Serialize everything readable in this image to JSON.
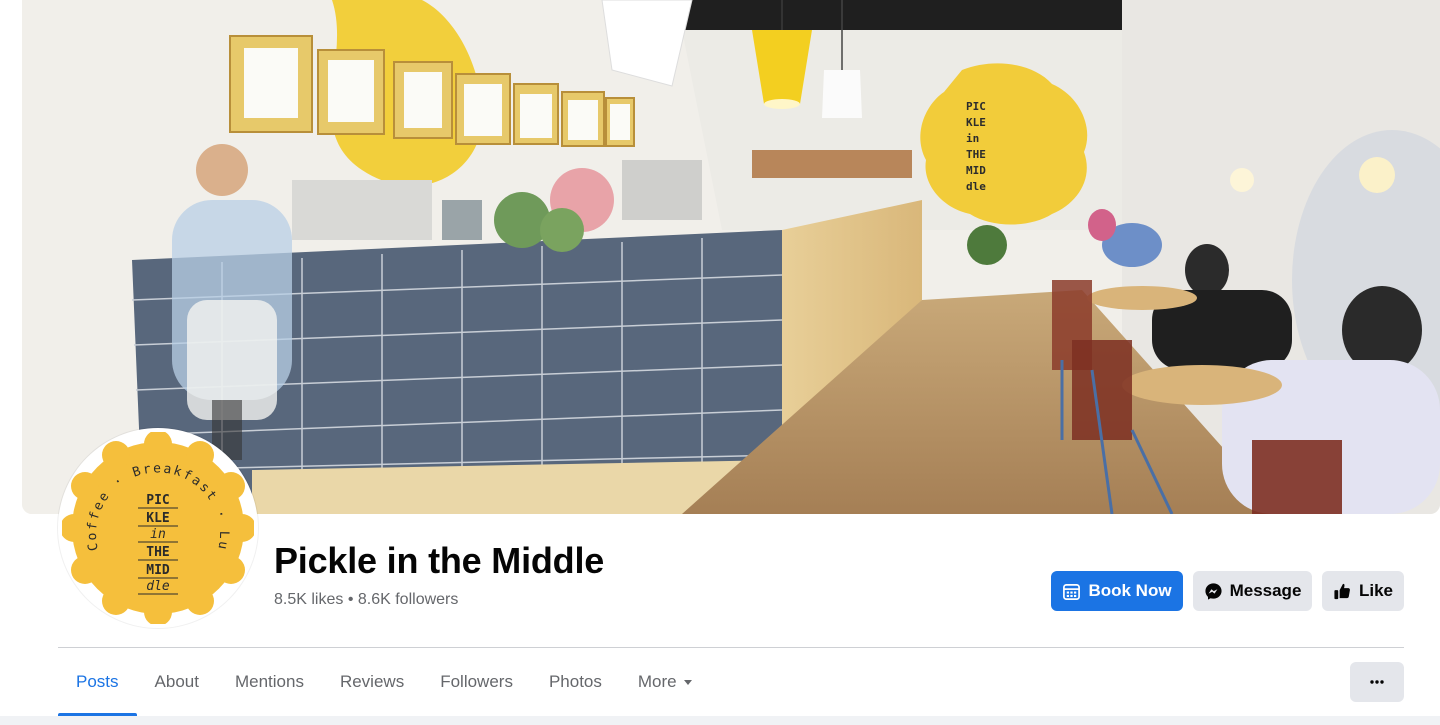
{
  "page": {
    "name": "Pickle in the Middle",
    "likes": "8.5K likes",
    "separator": " • ",
    "followers": "8.6K followers"
  },
  "cover": {
    "wall_logo": [
      "PIC",
      "KLE",
      "in",
      "THE",
      "MID",
      "dle"
    ]
  },
  "avatar": {
    "arc_text": "Coffee · Breakfast · Lunch",
    "logo_lines": [
      "PIC",
      "KLE",
      "in",
      "THE",
      "MID",
      "dle"
    ]
  },
  "actions": {
    "book_now": "Book Now",
    "message": "Message",
    "like": "Like"
  },
  "tabs": [
    {
      "label": "Posts",
      "active": true
    },
    {
      "label": "About"
    },
    {
      "label": "Mentions"
    },
    {
      "label": "Reviews"
    },
    {
      "label": "Followers"
    },
    {
      "label": "Photos"
    },
    {
      "label": "More"
    }
  ],
  "colors": {
    "accent": "#1b74e4",
    "brand_yellow": "#f2c94c",
    "secondary_button": "#e4e6eb",
    "muted_text": "#65676b"
  },
  "icons": {
    "book_now": "calendar-icon",
    "message": "messenger-icon",
    "like": "thumbs-up-icon",
    "more_tab": "caret-down-icon",
    "overflow": "ellipsis-icon"
  }
}
